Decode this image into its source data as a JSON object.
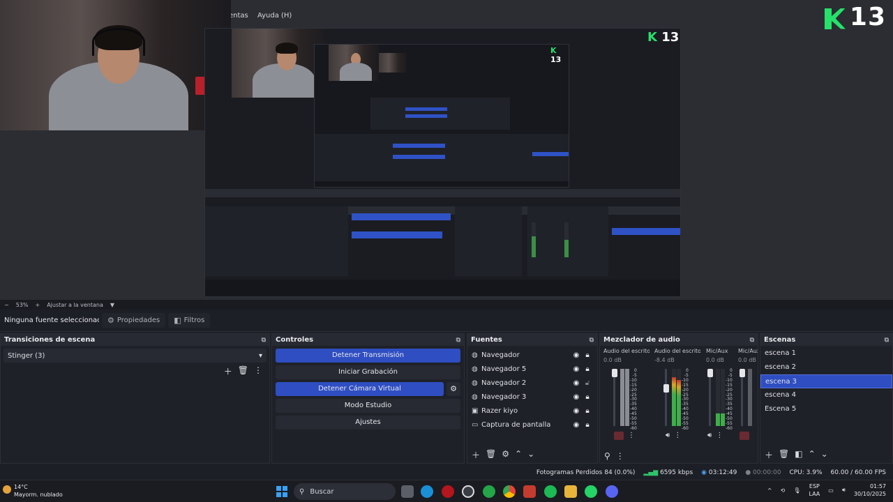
{
  "menubar": {
    "items": [
      "entas",
      "Ayuda (H)"
    ]
  },
  "logo": {
    "number": "13"
  },
  "zoom_bar": {
    "zoom": "53%",
    "fit_label": "Ajustar a la ventana"
  },
  "source_bar": {
    "no_source": "Ninguna fuente seleccionac",
    "properties": "Propiedades",
    "filters": "Filtros"
  },
  "transitions": {
    "title": "Transiciones de escena",
    "selected": "Stinger (3)"
  },
  "controls": {
    "title": "Controles",
    "stop_stream": "Detener Transmisión",
    "start_recording": "Iniciar Grabación",
    "stop_virtual_cam": "Detener Cámara Virtual",
    "studio_mode": "Modo Estudio",
    "settings": "Ajustes"
  },
  "sources": {
    "title": "Fuentes",
    "items": [
      {
        "name": "Navegador",
        "icon": "globe-icon"
      },
      {
        "name": "Navegador 5",
        "icon": "globe-icon"
      },
      {
        "name": "Navegador 2",
        "icon": "globe-icon"
      },
      {
        "name": "Navegador 3",
        "icon": "globe-icon"
      },
      {
        "name": "Razer kiyo",
        "icon": "camera-icon"
      },
      {
        "name": "Captura de pantalla",
        "icon": "monitor-icon"
      }
    ]
  },
  "mixer": {
    "title": "Mezclador de audio",
    "channels": [
      {
        "name": "Audio del escritorio",
        "db": "0.0 dB",
        "level": 0.0
      },
      {
        "name": "Audio del escritorio",
        "db": "-8.4 dB",
        "level": 0.55
      },
      {
        "name": "Mic/Aux",
        "db": "0.0 dB",
        "level": 0.25
      },
      {
        "name": "Mic/Aux",
        "db": "0.0 dB",
        "level": 0.0
      }
    ],
    "scale": [
      "0",
      "-5",
      "-10",
      "-15",
      "-20",
      "-25",
      "-30",
      "-35",
      "-40",
      "-45",
      "-50",
      "-55",
      "-60"
    ]
  },
  "scenes": {
    "title": "Escenas",
    "items": [
      "escena 1",
      "escena 2",
      "escena 3",
      "escena 4",
      "Escena 5"
    ],
    "selected_index": 2
  },
  "status": {
    "dropped_frames": "Fotogramas Perdidos 84 (0.0%)",
    "bitrate": "6595 kbps",
    "stream_time": "03:12:49",
    "record_time": "00:00:00",
    "cpu": "CPU: 3.9%",
    "fps": "60.00 / 60.00 FPS"
  },
  "taskbar": {
    "weather_temp": "14°C",
    "weather_desc": "Mayorm. nublado",
    "search_placeholder": "Buscar",
    "lang_top": "ESP",
    "lang_bottom": "LAA",
    "time": "01:57",
    "date": "30/10/2025"
  },
  "colors": {
    "accent": "#2f4ec2",
    "logo_green": "#25e26b"
  }
}
